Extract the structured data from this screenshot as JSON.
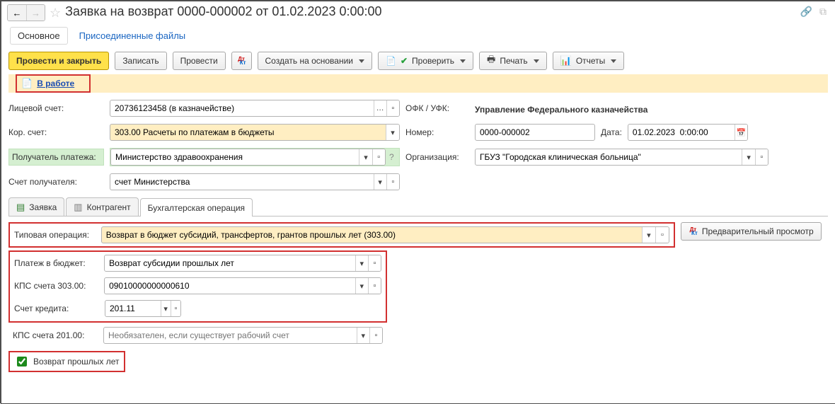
{
  "title": "Заявка на возврат 0000-000002 от 01.02.2023 0:00:00",
  "view_tabs": {
    "main": "Основное",
    "attached": "Присоединенные файлы"
  },
  "toolbar": {
    "post_and_close": "Провести и закрыть",
    "write": "Записать",
    "post": "Провести",
    "create_based_on": "Создать на основании",
    "check": "Проверить",
    "print": "Печать",
    "reports": "Отчеты"
  },
  "status": {
    "label": "В работе"
  },
  "labels": {
    "personal_account": "Лицевой счет:",
    "kor_account": "Кор. счет:",
    "payee": "Получатель платежа:",
    "payee_account": "Счет получателя:",
    "ofk": "ОФК / УФК:",
    "number": "Номер:",
    "date": "Дата:",
    "organization": "Организация:",
    "typical_op": "Типовая операция:",
    "budget_payment": "Платеж в бюджет:",
    "kps303": "КПС счета 303.00:",
    "credit_account": "Счет кредита:",
    "kps201": "КПС счета 201.00:",
    "return_prev_years": "Возврат прошлых лет",
    "preview": "Предварительный просмотр"
  },
  "values": {
    "personal_account": "20736123458 (в казначействе)",
    "kor_account": "303.00 Расчеты по платежам в бюджеты",
    "payee": "Министерство здравоохранения",
    "payee_account": "счет Министерства",
    "ofk_text": "Управление Федерального казначейства",
    "number": "0000-000002",
    "date": "01.02.2023  0:00:00",
    "organization": "ГБУЗ \"Городская клиническая больница\"",
    "typical_op": "Возврат в бюджет субсидий, трансфертов, грантов прошлых лет (303.00)",
    "budget_payment": "Возврат субсидии прошлых лет",
    "kps303": "09010000000000610",
    "credit_account": "201.11",
    "kps201_placeholder": "Необязателен, если существует рабочий счет",
    "return_prev_years_checked": true
  },
  "tabs": {
    "request": "Заявка",
    "counterparty": "Контрагент",
    "accounting": "Бухгалтерская операция"
  }
}
